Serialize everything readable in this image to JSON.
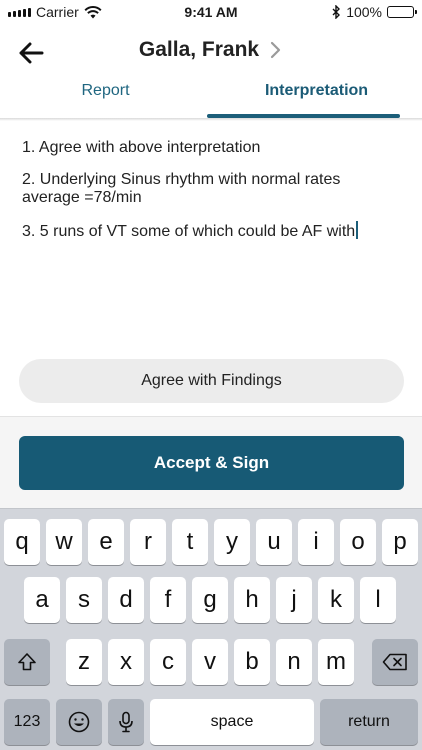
{
  "status_bar": {
    "carrier": "Carrier",
    "time": "9:41 AM",
    "battery_percent": "100%",
    "battery_level": 1.0
  },
  "header": {
    "title": "Galla, Frank",
    "back_icon": "arrow-left-icon",
    "chevron_icon": "chevron-right-icon"
  },
  "tabs": [
    {
      "label": "Report",
      "active": false
    },
    {
      "label": "Interpretation",
      "active": true
    }
  ],
  "interpretation": {
    "lines": [
      "1. Agree with above interpretation",
      "2. Underlying Sinus rhythm with normal rates average =78/min",
      "3. 5 runs of VT some of which could be AF with"
    ]
  },
  "buttons": {
    "agree_label": "Agree with Findings",
    "accept_label": "Accept & Sign"
  },
  "keyboard": {
    "row1": [
      "q",
      "w",
      "e",
      "r",
      "t",
      "y",
      "u",
      "i",
      "o",
      "p"
    ],
    "row2": [
      "a",
      "s",
      "d",
      "f",
      "g",
      "h",
      "j",
      "k",
      "l"
    ],
    "row3": [
      "z",
      "x",
      "c",
      "v",
      "b",
      "n",
      "m"
    ],
    "numbers_label": "123",
    "space_label": "space",
    "return_label": "return",
    "shift_icon": "shift-icon",
    "backspace_icon": "backspace-icon",
    "emoji_icon": "emoji-icon",
    "mic_icon": "microphone-icon"
  },
  "colors": {
    "accent": "#175a75",
    "tab_active": "#1b5b76",
    "tab_inactive": "#1f6680",
    "keyboard_bg": "#d2d5db"
  }
}
